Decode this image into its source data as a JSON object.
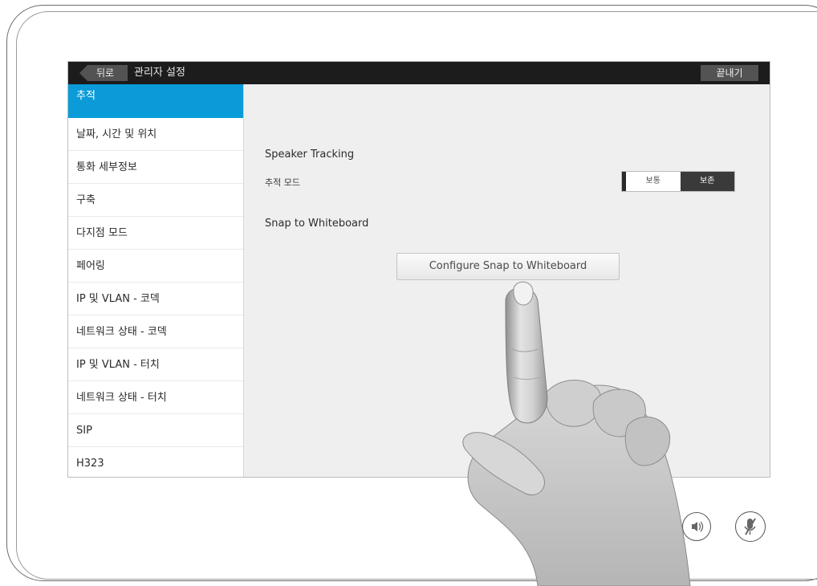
{
  "header": {
    "back_label": "뒤로",
    "title": "관리자 설정",
    "exit_label": "끝내기"
  },
  "sidebar": {
    "items": [
      {
        "label": "추적",
        "active": true
      },
      {
        "label": "날짜, 시간 및 위치"
      },
      {
        "label": "통화 세부정보"
      },
      {
        "label": "구축"
      },
      {
        "label": "다지점 모드"
      },
      {
        "label": "페어링"
      },
      {
        "label": "IP 및 VLAN - 코덱"
      },
      {
        "label": "네트워크 상태 - 코덱"
      },
      {
        "label": "IP 및 VLAN - 터치"
      },
      {
        "label": "네트워크 상태 - 터치"
      },
      {
        "label": "SIP"
      },
      {
        "label": "H323"
      }
    ]
  },
  "main": {
    "speaker_tracking_title": "Speaker Tracking",
    "tracking_mode_label": "추적 모드",
    "tracking_mode_options": [
      "보통",
      "보존"
    ],
    "tracking_mode_selected": "보존",
    "snap_title": "Snap to Whiteboard",
    "configure_button_label": "Configure Snap to Whiteboard"
  },
  "device_controls": {
    "volume_icon": "volume-icon",
    "mute_icon": "microphone-mute-icon"
  },
  "colors": {
    "accent": "#0a9bd8",
    "header_bg": "#1c1c1c"
  }
}
